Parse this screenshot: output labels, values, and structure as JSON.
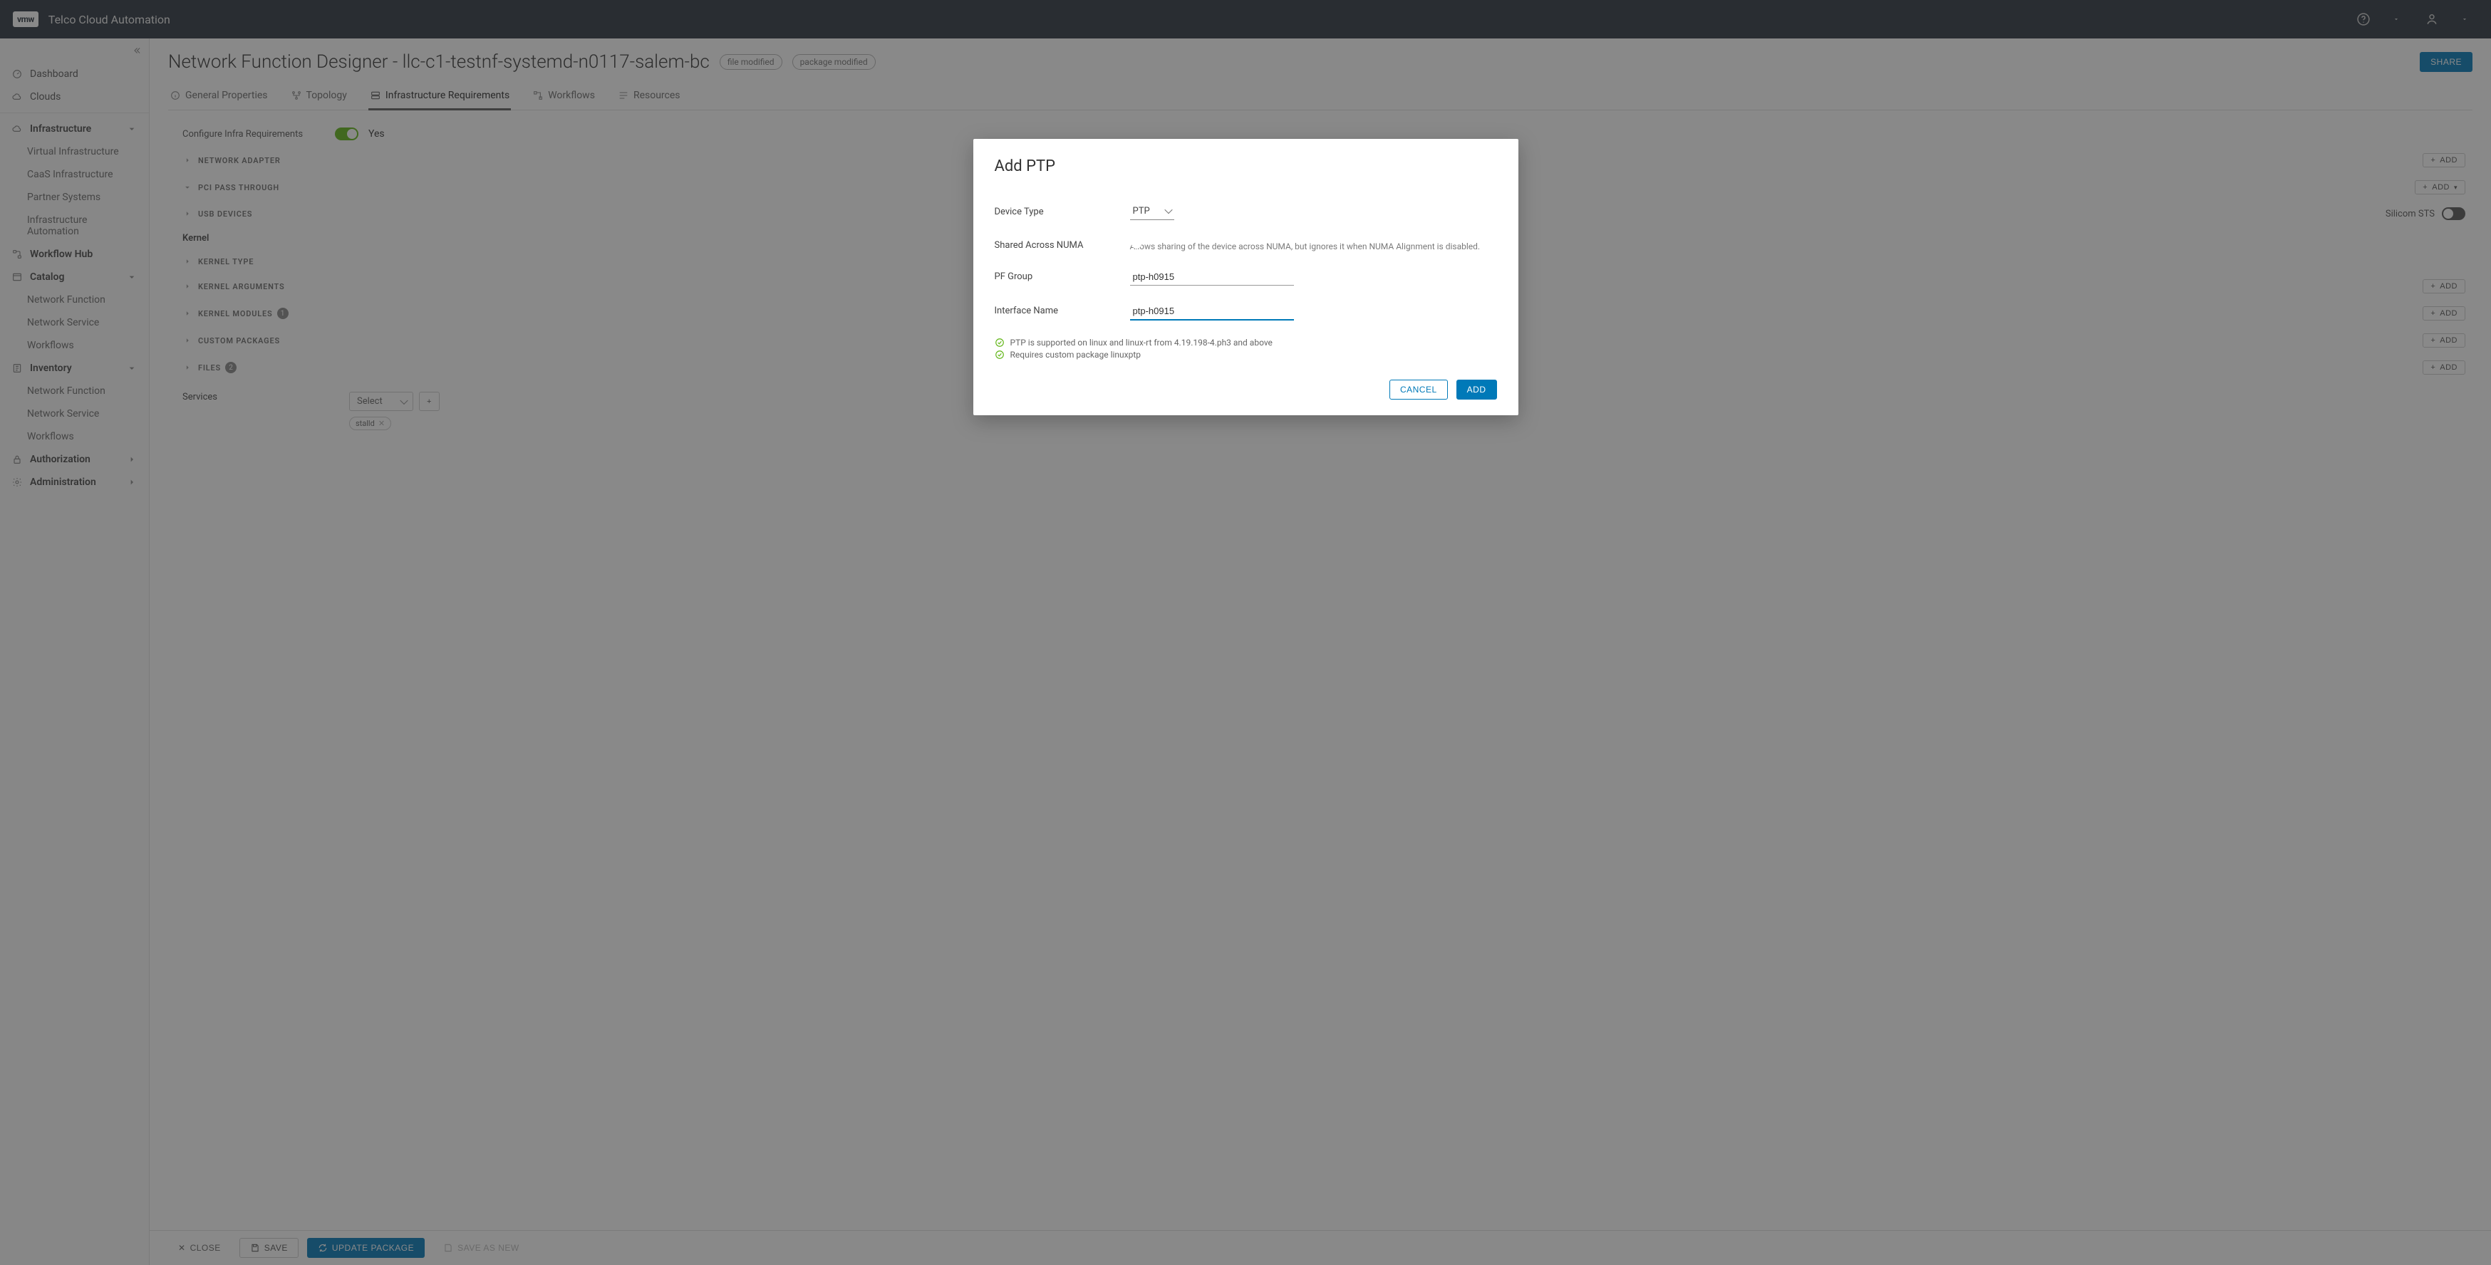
{
  "brand": {
    "logo": "vmw",
    "product": "Telco Cloud Automation"
  },
  "sidebar": {
    "dashboard": "Dashboard",
    "clouds": "Clouds",
    "infrastructure": {
      "label": "Infrastructure",
      "items": [
        "Virtual Infrastructure",
        "CaaS Infrastructure",
        "Partner Systems",
        "Infrastructure Automation"
      ]
    },
    "workflow_hub": "Workflow Hub",
    "catalog": {
      "label": "Catalog",
      "items": [
        "Network Function",
        "Network Service",
        "Workflows"
      ]
    },
    "inventory": {
      "label": "Inventory",
      "items": [
        "Network Function",
        "Network Service",
        "Workflows"
      ]
    },
    "authorization": "Authorization",
    "administration": "Administration"
  },
  "page": {
    "title": "Network Function Designer - llc-c1-testnf-systemd-n0117-salem-bc",
    "pill_file": "file modified",
    "pill_pkg": "package modified",
    "share": "SHARE"
  },
  "tabs": {
    "general": "General Properties",
    "topology": "Topology",
    "infra": "Infrastructure Requirements",
    "workflows": "Workflows",
    "resources": "Resources"
  },
  "infra": {
    "configure_label": "Configure Infra Requirements",
    "configure_value": "Yes",
    "add": "ADD",
    "sections": {
      "net_adapter": "NETWORK ADAPTER",
      "pci": "PCI PASS THROUGH",
      "usb": "USB DEVICES",
      "kernel_type": "KERNEL TYPE",
      "kernel_args": "KERNEL ARGUMENTS",
      "kernel_mods": "KERNEL MODULES",
      "custom_pkg": "CUSTOM PACKAGES",
      "files": "FILES"
    },
    "kernel_label": "Kernel",
    "kernel_mods_count": "1",
    "files_count": "2",
    "sts_label": "Silicom STS",
    "services_label": "Services",
    "services_select": "Select",
    "services_chip": "stalld"
  },
  "footer": {
    "close": "CLOSE",
    "save": "SAVE",
    "update": "UPDATE PACKAGE",
    "save_as_new": "SAVE AS NEW"
  },
  "modal": {
    "title": "Add PTP",
    "device_type_label": "Device Type",
    "device_type_value": "PTP",
    "shared_label": "Shared Across NUMA",
    "shared_help": "Allows sharing of the device across NUMA, but ignores it when NUMA Alignment is disabled.",
    "pf_group_label": "PF Group",
    "pf_group_value": "ptp-h0915",
    "iface_label": "Interface Name",
    "iface_value": "ptp-h0915",
    "note1": "PTP is supported on linux and linux-rt from 4.19.198-4.ph3 and above",
    "note2": "Requires custom package linuxptp",
    "cancel": "CANCEL",
    "add": "ADD"
  }
}
